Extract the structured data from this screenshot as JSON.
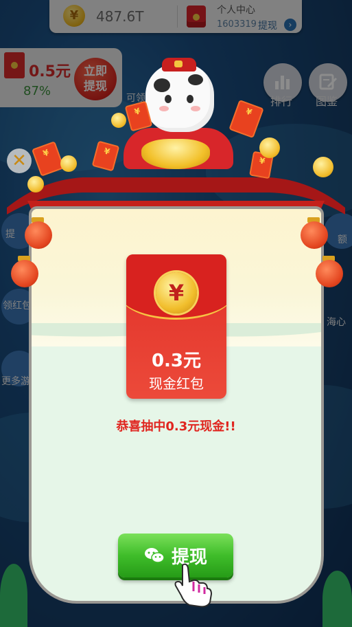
{
  "topbar": {
    "coin_amount": "487.6T",
    "profile_title": "个人中心",
    "profile_id": "1603319",
    "profile_link": "提现",
    "profile_chev": "›"
  },
  "reward_pill": {
    "amount": "0.5元",
    "percent": "87%",
    "withdraw_line1": "立即",
    "withdraw_line2": "提现"
  },
  "side": {
    "rank_label": "排行",
    "atlas_label": "图鉴",
    "cow_label": "可领"
  },
  "left_strip": {
    "item1": "提",
    "item2": "领红包",
    "item3": "更多游"
  },
  "right_strip": {
    "item1": "额",
    "item2": "海心"
  },
  "close": {
    "icon": "✕"
  },
  "envelope": {
    "coin_symbol": "¥",
    "amount": "0.3元",
    "description": "现金红包"
  },
  "congrats": "恭喜抽中0.3元现金!!",
  "withdraw_button": {
    "label": "提现"
  },
  "colors": {
    "accent_red": "#e0251f",
    "button_green": "#3fbd2a",
    "gold": "#f1be2c"
  }
}
